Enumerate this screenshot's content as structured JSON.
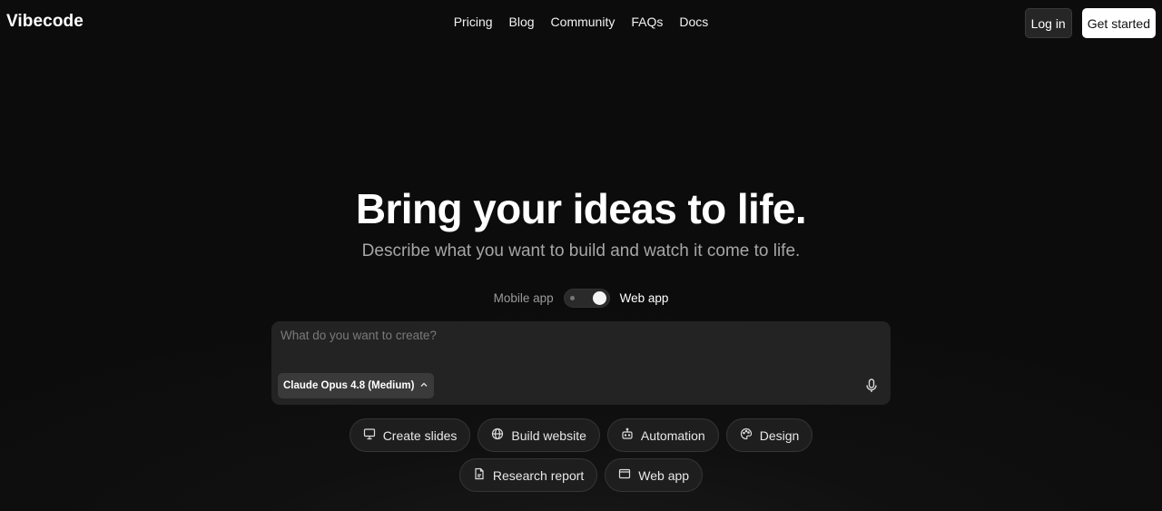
{
  "header": {
    "logo": "Vibecode",
    "nav": [
      "Pricing",
      "Blog",
      "Community",
      "FAQs",
      "Docs"
    ],
    "login_label": "Log in",
    "cta_label": "Get started"
  },
  "hero": {
    "title": "Bring your ideas to life.",
    "subtitle": "Describe what you want to build and watch it come to life."
  },
  "mode_toggle": {
    "left_label": "Mobile app",
    "right_label": "Web app",
    "selected": "Web app"
  },
  "prompt": {
    "placeholder": "What do you want to create?",
    "value": "",
    "model_label": "Claude Opus 4.8 (Medium)"
  },
  "chips": {
    "row1": [
      {
        "label": "Create slides",
        "icon": "presentation-icon"
      },
      {
        "label": "Build website",
        "icon": "globe-icon"
      },
      {
        "label": "Automation",
        "icon": "robot-icon"
      },
      {
        "label": "Design",
        "icon": "palette-icon"
      }
    ],
    "row2": [
      {
        "label": "Research report",
        "icon": "document-icon"
      },
      {
        "label": "Web app",
        "icon": "browser-window-icon"
      }
    ]
  },
  "colors": {
    "background": "#0c0c0c",
    "prompt_bg": "#232323",
    "chip_bg": "#1e1e1e",
    "muted_text": "#a6a6a6"
  }
}
